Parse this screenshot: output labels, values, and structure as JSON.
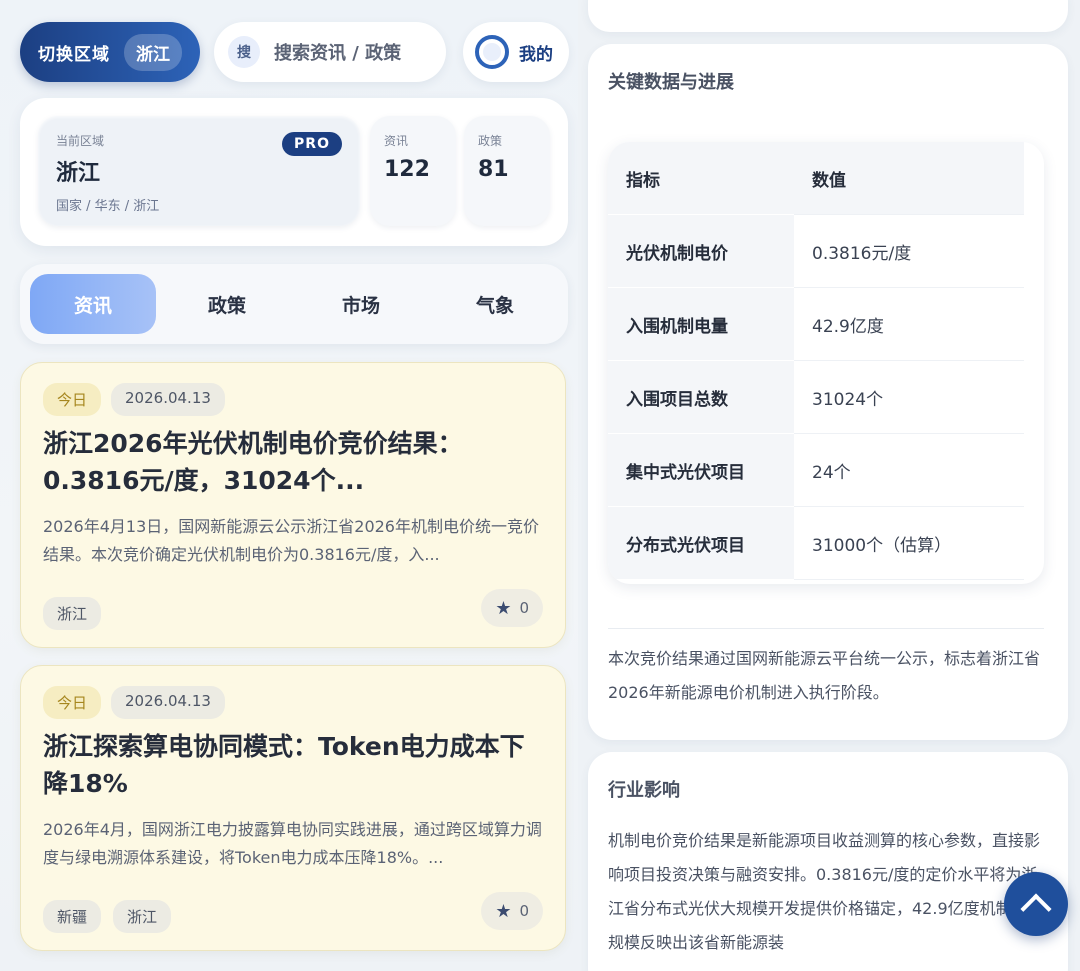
{
  "topbar": {
    "region_label": "切换区域",
    "region_value": "浙江",
    "search_icon_text": "搜",
    "search_placeholder": "搜索资讯 / 政策",
    "me_label": "我的"
  },
  "region_card": {
    "caption": "当前区域",
    "name": "浙江",
    "path": "国家 / 华东 / 浙江",
    "badge": "PRO",
    "stats": [
      {
        "label": "资讯",
        "value": "122"
      },
      {
        "label": "政策",
        "value": "81"
      }
    ]
  },
  "tabs": [
    {
      "label": "资讯",
      "active": true
    },
    {
      "label": "政策",
      "active": false
    },
    {
      "label": "市场",
      "active": false
    },
    {
      "label": "气象",
      "active": false
    }
  ],
  "news": [
    {
      "today": "今日",
      "date": "2026.04.13",
      "title": "浙江2026年光伏机制电价竞价结果：0.3816元/度，31024个...",
      "summary": "2026年4月13日，国网新能源云公示浙江省2026年机制电价统一竞价结果。本次竞价确定光伏机制电价为0.3816元/度，入...",
      "tags": [
        "浙江"
      ],
      "favorites": "0"
    },
    {
      "today": "今日",
      "date": "2026.04.13",
      "title": "浙江探索算电协同模式：Token电力成本下降18%",
      "summary": "2026年4月，国网浙江电力披露算电协同实践进展，通过跨区域算力调度与绿电溯源体系建设，将Token电力成本压降18%。...",
      "tags": [
        "新疆",
        "浙江"
      ],
      "favorites": "0"
    }
  ],
  "detail": {
    "section_title": "关键数据与进展",
    "table_header": {
      "metric": "指标",
      "value": "数值"
    },
    "table_rows": [
      {
        "metric": "光伏机制电价",
        "value": "0.3816元/度"
      },
      {
        "metric": "入围机制电量",
        "value": "42.9亿度"
      },
      {
        "metric": "入围项目总数",
        "value": "31024个"
      },
      {
        "metric": "集中式光伏项目",
        "value": "24个"
      },
      {
        "metric": "分布式光伏项目",
        "value": "31000个（估算）"
      }
    ],
    "paragraph": "本次竞价结果通过国网新能源云平台统一公示，标志着浙江省2026年新能源电价机制进入执行阶段。",
    "impact_title": "行业影响",
    "impact_text": "机制电价竞价结果是新能源项目收益测算的核心参数，直接影响项目投资决策与融资安排。0.3816元/度的定价水平将为浙江省分布式光伏大规模开发提供价格锚定，42.9亿度机制电量规模反映出该省新能源装"
  },
  "colors": {
    "accent": "#1c3f82",
    "tab_active": "#7fa8f5",
    "news_card_bg": "#fdf9e4",
    "fab": "#1f4f9c"
  },
  "icons": [
    "search-icon",
    "user-avatar-icon",
    "star-icon",
    "chevron-up-icon"
  ]
}
